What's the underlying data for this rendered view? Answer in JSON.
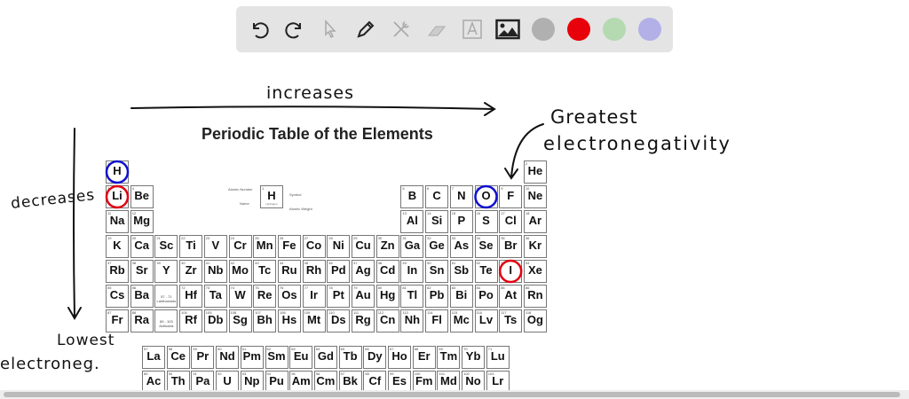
{
  "toolbar": {
    "tools": [
      "undo-icon",
      "redo-icon",
      "select-icon",
      "pen-icon",
      "tools-icon",
      "eraser-icon",
      "text-icon",
      "image-icon"
    ],
    "colors": [
      "#b0b0b0",
      "#e8000b",
      "#b5d9b0",
      "#b3b0e8"
    ]
  },
  "title": "Periodic Table of the Elements",
  "annotations": {
    "top": "increases",
    "right1": "Greatest",
    "right2": "electronegativity",
    "left": "decreases",
    "bottom1": "Lowest",
    "bottom2": "electroneg."
  },
  "legend": {
    "atomic_number": "Atomic Number",
    "name": "Name",
    "symbol": "Symbol",
    "atomic_weight": "Atomic Weight",
    "sample_symbol": "H",
    "sample_name": "Hydrogen",
    "sample_number": "1"
  },
  "circles": [
    {
      "symbol": "H",
      "color": "#1010d0"
    },
    {
      "symbol": "Li",
      "color": "#e00010"
    },
    {
      "symbol": "O",
      "color": "#1010d0"
    },
    {
      "symbol": "I",
      "color": "#e00010"
    }
  ],
  "periods": [
    [
      [
        "H",
        1
      ],
      null,
      null,
      null,
      null,
      null,
      null,
      null,
      null,
      null,
      null,
      null,
      null,
      null,
      null,
      null,
      null,
      [
        "He",
        2
      ]
    ],
    [
      [
        "Li",
        3
      ],
      [
        "Be",
        4
      ],
      null,
      null,
      null,
      null,
      null,
      null,
      null,
      null,
      null,
      null,
      [
        "B",
        5
      ],
      [
        "C",
        6
      ],
      [
        "N",
        7
      ],
      [
        "O",
        8
      ],
      [
        "F",
        9
      ],
      [
        "Ne",
        10
      ]
    ],
    [
      [
        "Na",
        11
      ],
      [
        "Mg",
        12
      ],
      null,
      null,
      null,
      null,
      null,
      null,
      null,
      null,
      null,
      null,
      [
        "Al",
        13
      ],
      [
        "Si",
        14
      ],
      [
        "P",
        15
      ],
      [
        "S",
        16
      ],
      [
        "Cl",
        17
      ],
      [
        "Ar",
        18
      ]
    ],
    [
      [
        "K",
        19
      ],
      [
        "Ca",
        20
      ],
      [
        "Sc",
        21
      ],
      [
        "Ti",
        22
      ],
      [
        "V",
        23
      ],
      [
        "Cr",
        24
      ],
      [
        "Mn",
        25
      ],
      [
        "Fe",
        26
      ],
      [
        "Co",
        27
      ],
      [
        "Ni",
        28
      ],
      [
        "Cu",
        29
      ],
      [
        "Zn",
        30
      ],
      [
        "Ga",
        31
      ],
      [
        "Ge",
        32
      ],
      [
        "As",
        33
      ],
      [
        "Se",
        34
      ],
      [
        "Br",
        35
      ],
      [
        "Kr",
        36
      ]
    ],
    [
      [
        "Rb",
        37
      ],
      [
        "Sr",
        38
      ],
      [
        "Y",
        39
      ],
      [
        "Zr",
        40
      ],
      [
        "Nb",
        41
      ],
      [
        "Mo",
        42
      ],
      [
        "Tc",
        43
      ],
      [
        "Ru",
        44
      ],
      [
        "Rh",
        45
      ],
      [
        "Pd",
        46
      ],
      [
        "Ag",
        47
      ],
      [
        "Cd",
        48
      ],
      [
        "In",
        49
      ],
      [
        "Sn",
        50
      ],
      [
        "Sb",
        51
      ],
      [
        "Te",
        52
      ],
      [
        "I",
        53
      ],
      [
        "Xe",
        54
      ]
    ],
    [
      [
        "Cs",
        55
      ],
      [
        "Ba",
        56
      ],
      [
        "57 - 71 Lanthanoids",
        0
      ],
      [
        "Hf",
        72
      ],
      [
        "Ta",
        73
      ],
      [
        "W",
        74
      ],
      [
        "Re",
        75
      ],
      [
        "Os",
        76
      ],
      [
        "Ir",
        77
      ],
      [
        "Pt",
        78
      ],
      [
        "Au",
        79
      ],
      [
        "Hg",
        80
      ],
      [
        "Tl",
        81
      ],
      [
        "Pb",
        82
      ],
      [
        "Bi",
        83
      ],
      [
        "Po",
        84
      ],
      [
        "At",
        85
      ],
      [
        "Rn",
        86
      ]
    ],
    [
      [
        "Fr",
        87
      ],
      [
        "Ra",
        88
      ],
      [
        "89 - 103 Actinoids",
        0
      ],
      [
        "Rf",
        104
      ],
      [
        "Db",
        105
      ],
      [
        "Sg",
        106
      ],
      [
        "Bh",
        107
      ],
      [
        "Hs",
        108
      ],
      [
        "Mt",
        109
      ],
      [
        "Ds",
        110
      ],
      [
        "Rg",
        111
      ],
      [
        "Cn",
        112
      ],
      [
        "Nh",
        113
      ],
      [
        "Fl",
        114
      ],
      [
        "Mc",
        115
      ],
      [
        "Lv",
        116
      ],
      [
        "Ts",
        117
      ],
      [
        "Og",
        118
      ]
    ]
  ],
  "lanthanoids": [
    [
      "La",
      57
    ],
    [
      "Ce",
      58
    ],
    [
      "Pr",
      59
    ],
    [
      "Nd",
      60
    ],
    [
      "Pm",
      61
    ],
    [
      "Sm",
      62
    ],
    [
      "Eu",
      63
    ],
    [
      "Gd",
      64
    ],
    [
      "Tb",
      65
    ],
    [
      "Dy",
      66
    ],
    [
      "Ho",
      67
    ],
    [
      "Er",
      68
    ],
    [
      "Tm",
      69
    ],
    [
      "Yb",
      70
    ],
    [
      "Lu",
      71
    ]
  ],
  "actinoids": [
    [
      "Ac",
      89
    ],
    [
      "Th",
      90
    ],
    [
      "Pa",
      91
    ],
    [
      "U",
      92
    ],
    [
      "Np",
      93
    ],
    [
      "Pu",
      94
    ],
    [
      "Am",
      95
    ],
    [
      "Cm",
      96
    ],
    [
      "Bk",
      97
    ],
    [
      "Cf",
      98
    ],
    [
      "Es",
      99
    ],
    [
      "Fm",
      100
    ],
    [
      "Md",
      101
    ],
    [
      "No",
      102
    ],
    [
      "Lr",
      103
    ]
  ]
}
